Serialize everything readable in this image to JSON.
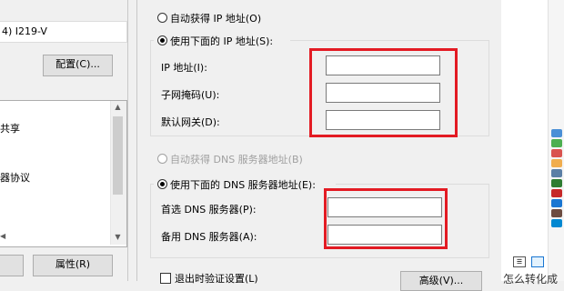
{
  "left_panel": {
    "adapter_name": "4) I219-V",
    "configure_label": "配置(C)...",
    "list_items": [
      "共享",
      "器协议"
    ],
    "properties_label": "属性(R)",
    "scroll_up": "▲",
    "scroll_down": "▼",
    "scroll_left": "◀"
  },
  "ip_section": {
    "auto_ip_label": "自动获得 IP 地址(O)",
    "manual_ip_label": "使用下面的 IP 地址(S):",
    "ip_address_label": "IP 地址(I):",
    "subnet_label": "子网掩码(U):",
    "gateway_label": "默认网关(D):",
    "ip_address_value": "",
    "subnet_value": "",
    "gateway_value": ""
  },
  "dns_section": {
    "auto_dns_label": "自动获得 DNS 服务器地址(B)",
    "manual_dns_label": "使用下面的 DNS 服务器地址(E):",
    "preferred_label": "首选 DNS 服务器(P):",
    "alternate_label": "备用 DNS 服务器(A):",
    "preferred_value": "",
    "alternate_value": ""
  },
  "footer": {
    "validate_label": "退出时验证设置(L)",
    "advanced_label": "高级(V)..."
  },
  "right_area": {
    "partial_text": "么",
    "bottom_text": "怎么转化成",
    "colors": [
      "#4a8fd6",
      "#4caf50",
      "#d9534f",
      "#f0ad4e",
      "#5b7fa6",
      "#2e7d32",
      "#c62828",
      "#1976d2",
      "#6d4c41",
      "#0288d1"
    ]
  },
  "highlight_color": "#e31b23"
}
